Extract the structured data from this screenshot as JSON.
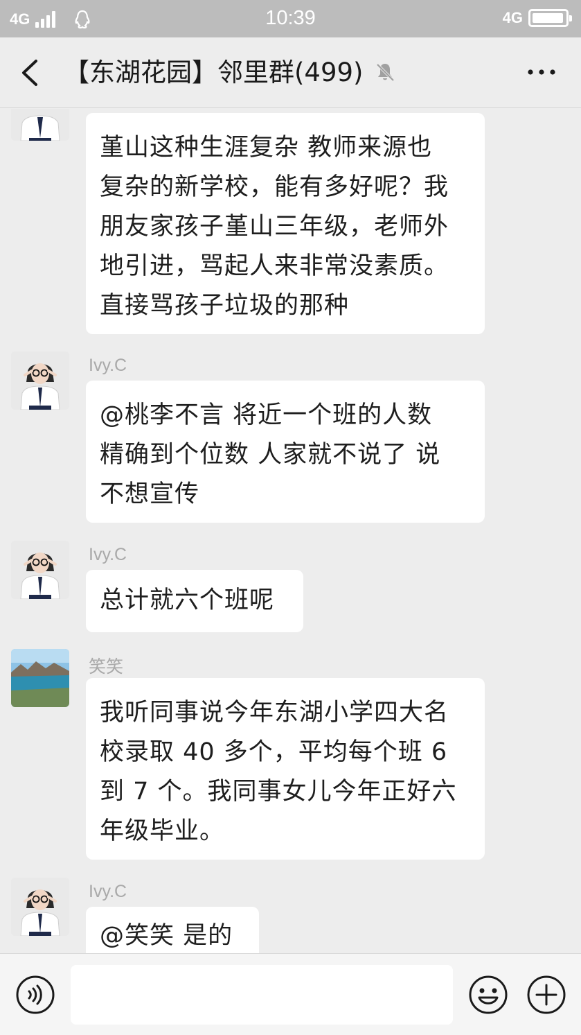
{
  "status_bar": {
    "network_left": "4G",
    "time": "10:39",
    "network_right": "4G",
    "battery_level": 0.95
  },
  "header": {
    "title": "【东湖花园】邻里群(499)",
    "muted": true
  },
  "messages": [
    {
      "sender": "",
      "avatar": "girl-glasses-avatar",
      "lines": [
        "堇山这种生涯复杂 教师来源也",
        "复杂的新学校，能有多好呢？我",
        "朋友家孩子堇山三年级，老师外",
        "地引进，骂起人来非常没素质。",
        "直接骂孩子垃圾的那种"
      ]
    },
    {
      "sender": "Ivy.C",
      "avatar": "girl-glasses-avatar",
      "lines": [
        "@桃李不言  将近一个班的人数",
        "精确到个位数 人家就不说了 说",
        "不想宣传"
      ]
    },
    {
      "sender": "Ivy.C",
      "avatar": "girl-glasses-avatar",
      "lines": [
        "总计就六个班呢"
      ]
    },
    {
      "sender": "笑笑",
      "avatar": "lake-landscape-avatar",
      "lines": [
        "我听同事说今年东湖小学四大名",
        "校录取 40 多个，平均每个班 6",
        "到 7 个。我同事女儿今年正好六",
        "年级毕业。"
      ]
    },
    {
      "sender": "Ivy.C",
      "avatar": "girl-glasses-avatar",
      "lines": [
        "@笑笑  是的"
      ]
    }
  ],
  "input": {
    "value": "",
    "placeholder": ""
  },
  "colors": {
    "status_bar": "#bcbcbc",
    "background": "#ededed",
    "bubble": "#ffffff",
    "sender_name": "#a9a9a9"
  }
}
